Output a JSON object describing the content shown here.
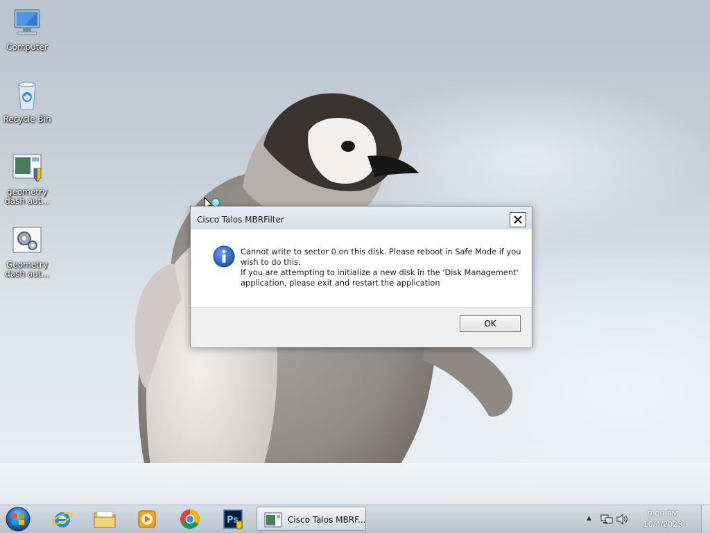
{
  "desktop": {
    "icons": [
      {
        "label_line1": "Computer",
        "label_line2": "",
        "icon": "computer-icon"
      },
      {
        "label_line1": "Recycle Bin",
        "label_line2": "",
        "icon": "recycle-bin-icon"
      },
      {
        "label_line1": "geometry",
        "label_line2": "dash aut...",
        "icon": "installer-shield-icon"
      },
      {
        "label_line1": "Geometry",
        "label_line2": "dash aut...",
        "icon": "settings-gears-icon"
      }
    ]
  },
  "dialog": {
    "title": "Cisco Talos MBRFilter",
    "icon": "info-icon",
    "message_lines": [
      "Cannot write to sector 0 on this disk. Please reboot in Safe Mode if you",
      "wish to do this.",
      "If you are attempting to initialize a new disk in the 'Disk Management'",
      "application, please exit and restart the application"
    ],
    "ok_label": "OK",
    "close_icon": "close-icon"
  },
  "taskbar": {
    "pinned": [
      "start-orb-icon",
      "internet-explorer-icon",
      "file-explorer-icon",
      "media-player-icon",
      "chrome-icon",
      "photoshop-icon"
    ],
    "active_task_label": "Cisco Talos MBRF...",
    "clock_time": "9:09 PM",
    "clock_date": "10/4/2023"
  },
  "colors": {
    "accent_blue": "#1c5fb8",
    "taskbar": "#c5ced8",
    "dialog_footer": "#f0f0f0"
  }
}
